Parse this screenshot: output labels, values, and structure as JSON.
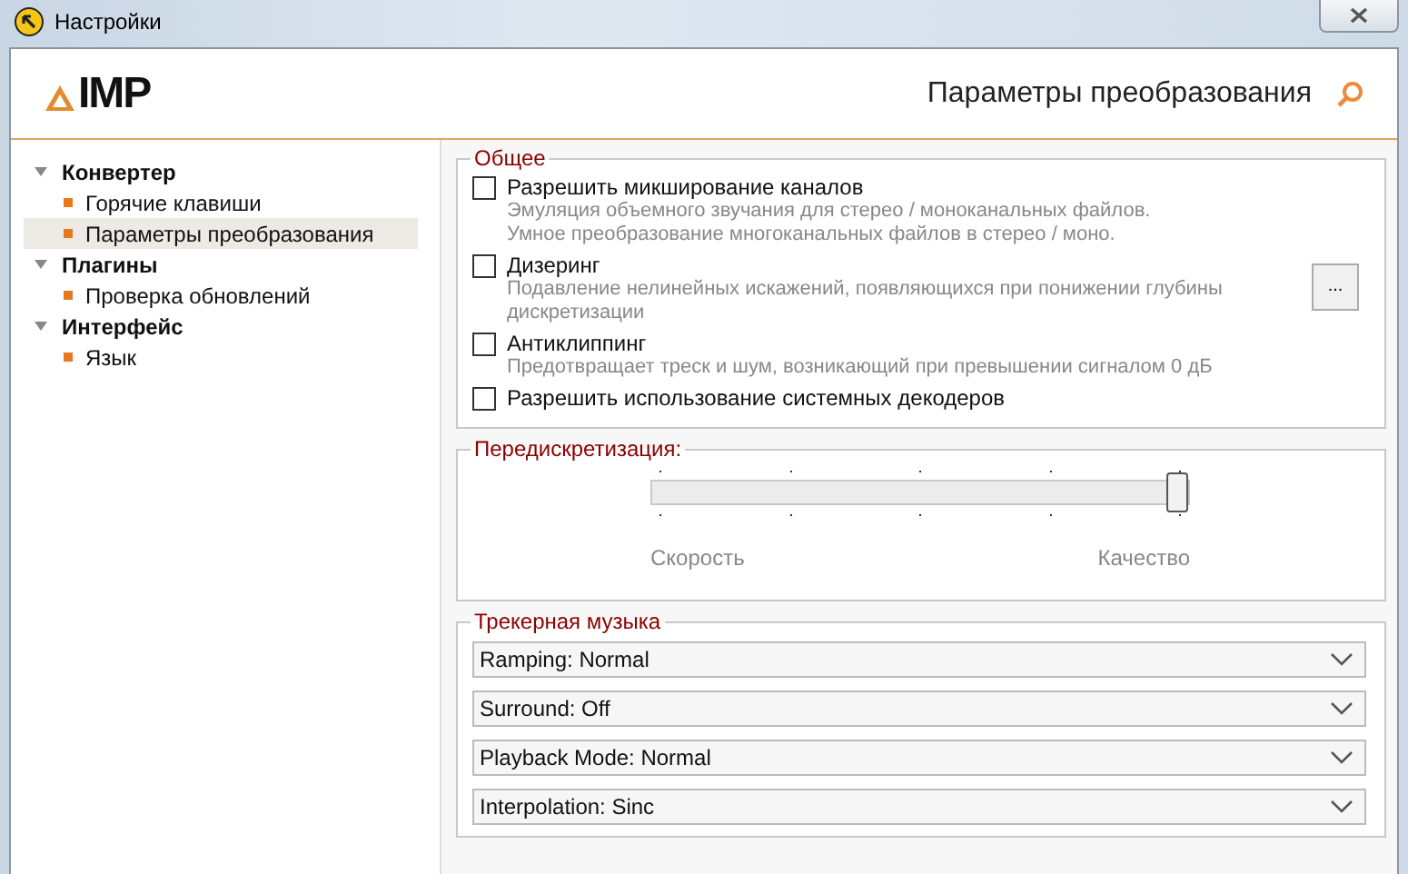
{
  "window": {
    "title": "Настройки"
  },
  "header": {
    "logo": "IMP",
    "title": "Параметры преобразования"
  },
  "sidebar": {
    "items": [
      {
        "label": "Конвертер",
        "expanded": true,
        "children": [
          {
            "label": "Горячие клавиши",
            "selected": false
          },
          {
            "label": "Параметры преобразования",
            "selected": true
          }
        ]
      },
      {
        "label": "Плагины",
        "expanded": true,
        "children": [
          {
            "label": "Проверка обновлений",
            "selected": false
          }
        ]
      },
      {
        "label": "Интерфейс",
        "expanded": true,
        "children": [
          {
            "label": "Язык",
            "selected": false
          }
        ]
      }
    ]
  },
  "general": {
    "title": "Общее",
    "options_button": "...",
    "options": [
      {
        "label": "Разрешить микширование каналов",
        "checked": false,
        "description": [
          "Эмуляция объемного звучания для стерео / моноканальных файлов.",
          "Умное преобразование многоканальных файлов в стерео / моно."
        ]
      },
      {
        "label": "Дизеринг",
        "checked": false,
        "description": [
          "Подавление нелинейных искажений, появляющихся при понижении глубины",
          "дискретизации"
        ]
      },
      {
        "label": "Антиклиппинг",
        "checked": false,
        "description": [
          "Предотвращает треск и шум, возникающий при превышении сигналом 0 дБ"
        ]
      },
      {
        "label": "Разрешить использование системных декодеров",
        "checked": false
      }
    ]
  },
  "resampling": {
    "title": "Передискретизация:",
    "level": 1.0,
    "min_label": "Скорость",
    "max_label": "Качество"
  },
  "tracker": {
    "title": "Трекерная музыка",
    "dropdowns": [
      "Ramping: Normal",
      "Surround: Off",
      "Playback Mode: Normal",
      "Interpolation: Sinc"
    ]
  }
}
